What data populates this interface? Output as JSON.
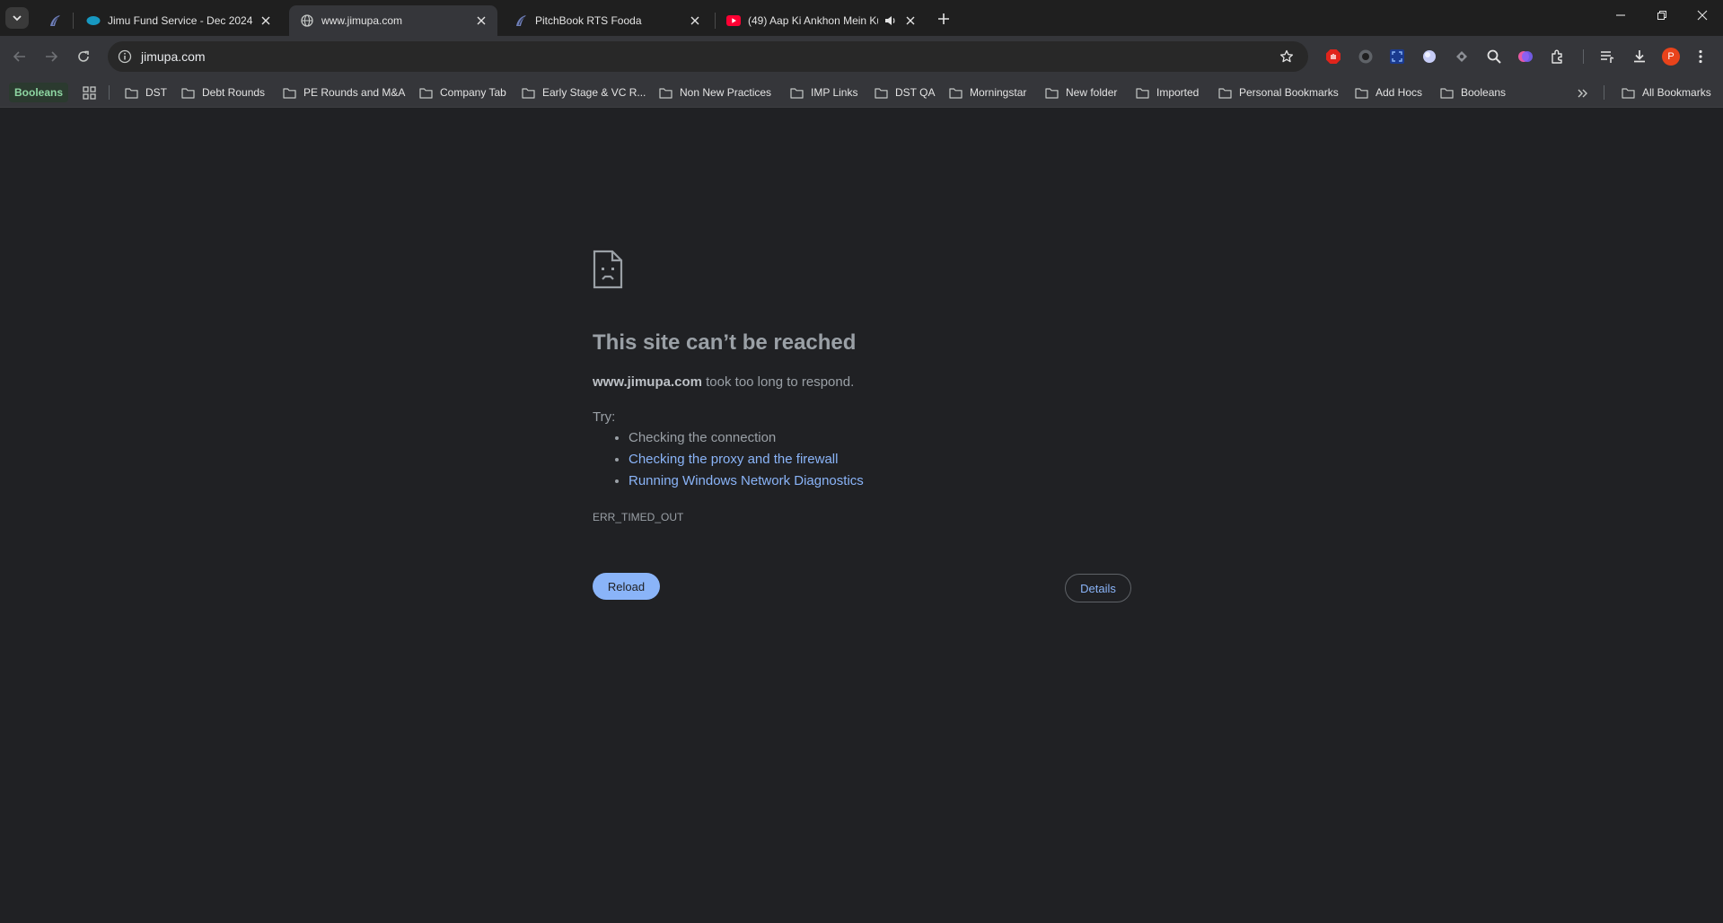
{
  "tabs": [
    {
      "title": "",
      "icon": "pitchbook-icon"
    },
    {
      "title": "Jimu Fund Service - Dec 2024 |",
      "icon": "salesforce-icon"
    },
    {
      "title": "www.jimupa.com",
      "icon": "globe-icon",
      "active": true
    },
    {
      "title": "PitchBook RTS Fooda",
      "icon": "pitchbook-icon"
    },
    {
      "title": "(49) Aap Ki Ankhon Mein Ku",
      "icon": "youtube-icon",
      "audio": true
    }
  ],
  "omnibox": {
    "url": "jimupa.com"
  },
  "profile": {
    "initial": "P",
    "color": "#e8431b"
  },
  "bookmarks": {
    "chip_label": "Booleans",
    "items": [
      "DST",
      "Debt Rounds",
      "PE Rounds and M&A",
      "Company Tab",
      "Early Stage & VC R...",
      "Non New Practices",
      "IMP Links",
      "DST QA",
      "Morningstar",
      "New folder",
      "Imported",
      "Personal Bookmarks",
      "Add Hocs",
      "Booleans"
    ],
    "all_bookmarks_label": "All Bookmarks"
  },
  "error": {
    "title": "This site can’t be reached",
    "host": "www.jimupa.com",
    "desc_rest": " took too long to respond.",
    "try_label": "Try:",
    "suggestions": [
      "Checking the connection",
      "Checking the proxy and the firewall",
      "Running Windows Network Diagnostics"
    ],
    "code": "ERR_TIMED_OUT",
    "reload_label": "Reload",
    "details_label": "Details"
  },
  "colors": {
    "page_bg": "#202124",
    "link": "#8ab4f8",
    "text_muted": "#9aa0a6"
  }
}
